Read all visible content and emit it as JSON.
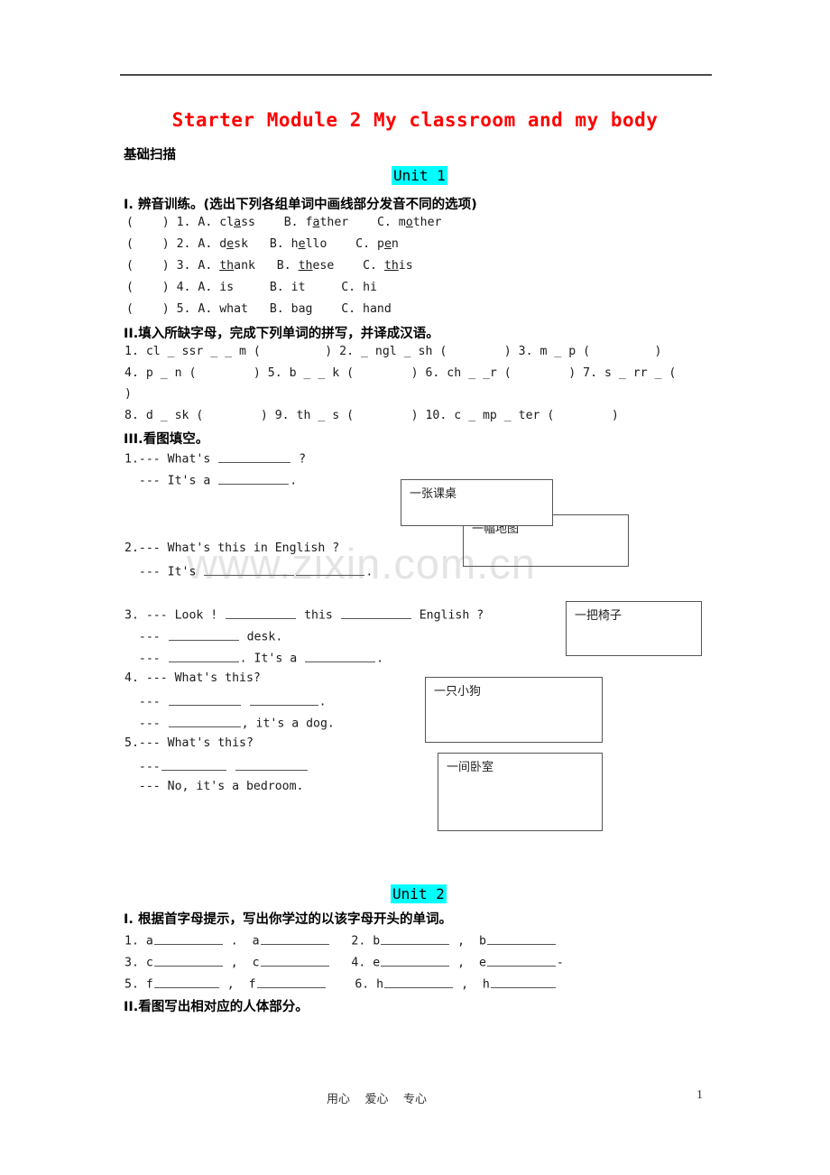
{
  "document": {
    "title": "Starter Module 2 My classroom and my body",
    "title_color": "#ff0000",
    "basic_label": "基础扫描",
    "watermark": "www.zixin.com.cn",
    "highlight_color": "#00ffff"
  },
  "unit1": {
    "tag": "Unit 1",
    "sectionI": {
      "heading": "I. 辨音训练。(选出下列各组单词中画线部分发音不同的选项)",
      "items": [
        {
          "num": "1.",
          "a_pre": "cl",
          "a_u": "a",
          "a_post": "ss",
          "b_pre": "f",
          "b_u": "a",
          "b_post": "ther",
          "c_pre": "m",
          "c_u": "o",
          "c_post": "ther"
        },
        {
          "num": "2.",
          "a_pre": "d",
          "a_u": "e",
          "a_post": "sk",
          "b_pre": "h",
          "b_u": "e",
          "b_post": "llo",
          "c_pre": "p",
          "c_u": "e",
          "c_post": "n"
        },
        {
          "num": "3.",
          "a_pre": "",
          "a_u": "th",
          "a_post": "ank",
          "b_pre": "",
          "b_u": "th",
          "b_post": "ese",
          "c_pre": "",
          "c_u": "th",
          "c_post": "is"
        },
        {
          "num": "4.",
          "a_pre": "is",
          "a_u": "",
          "a_post": "",
          "b_pre": "it",
          "b_u": "",
          "b_post": "",
          "c_pre": "hi",
          "c_u": "",
          "c_post": ""
        },
        {
          "num": "5.",
          "a_pre": "what",
          "a_u": "",
          "a_post": "",
          "b_pre": "bag",
          "b_u": "",
          "b_post": "",
          "c_pre": "hand",
          "c_u": "",
          "c_post": ""
        }
      ],
      "paren": "(    )",
      "optA": "A.",
      "optB": "B.",
      "optC": "C."
    },
    "sectionII": {
      "heading": "II.填入所缺字母，完成下列单词的拼写，并译成汉语。",
      "line1": "1. cl _ ssr _ _ m (         ) 2. _ ngl _ sh (        ) 3. m _ p (         )",
      "line2": "4. p _ n (        ) 5. b _ _ k (        ) 6. ch _ _r (        ) 7. s _ rr _ (",
      "line3": ")",
      "line4": "8. d _ sk (        ) 9. th _ s (        ) 10. c _ mp _ ter (        )"
    },
    "sectionIII": {
      "heading": "III.看图填空。",
      "q1": {
        "l1_a": "1.--- What's ",
        "l1_b": " ?",
        "l2_a": "  --- It's a ",
        "l2_b": "."
      },
      "q2": {
        "l1": "2.--- What's this in English ?",
        "l2_a": "  --- It's ",
        "l2_b": "."
      },
      "q3": {
        "l1_a": "3. --- Look ! ",
        "l1_b": " this ",
        "l1_c": " English ?",
        "l2_a": "  --- ",
        "l2_b": " desk.",
        "l3_a": "  --- ",
        "l3_b": ". It's a ",
        "l3_c": "."
      },
      "q4": {
        "l1": "4. --- What's this?",
        "l2_a": "  --- ",
        "l2_b": " ",
        "l2_c": ".",
        "l3_a": "  --- ",
        "l3_b": ", it's a dog."
      },
      "q5": {
        "l1": "5.--- What's this?",
        "l2_a": "  ---",
        "l2_b": " ",
        "l3": "  --- No, it's a bedroom."
      },
      "pictures": [
        {
          "name": "desk",
          "caption": "一张课桌"
        },
        {
          "name": "map",
          "caption": "一幅地图"
        },
        {
          "name": "chair",
          "caption": "一把椅子"
        },
        {
          "name": "dog",
          "caption": "一只小狗"
        },
        {
          "name": "bedroom",
          "caption": "一间卧室"
        }
      ]
    }
  },
  "unit2": {
    "tag": "Unit 2",
    "sectionI": {
      "heading": "I. 根据首字母提示，写出你学过的以该字母开头的单词。",
      "rows": [
        {
          "n1": "1.",
          "a1": "a",
          "sep1": ".",
          "a2": "a",
          "n2": "2.",
          "b1": "b",
          "sep2": ",",
          "b2": "b"
        },
        {
          "n1": "3.",
          "a1": "c",
          "sep1": ",",
          "a2": "c",
          "n2": "4.",
          "b1": "e",
          "sep2": ",",
          "b2": "e"
        },
        {
          "n1": "5.",
          "a1": "f",
          "sep1": ",",
          "a2": "f",
          "n2": "6.",
          "b1": "h",
          "sep2": ",",
          "b2": "h"
        }
      ]
    },
    "sectionII": {
      "heading": "II.看图写出相对应的人体部分。"
    }
  },
  "footer": {
    "motto": "用心    爱心    专心",
    "page_number": "1"
  }
}
